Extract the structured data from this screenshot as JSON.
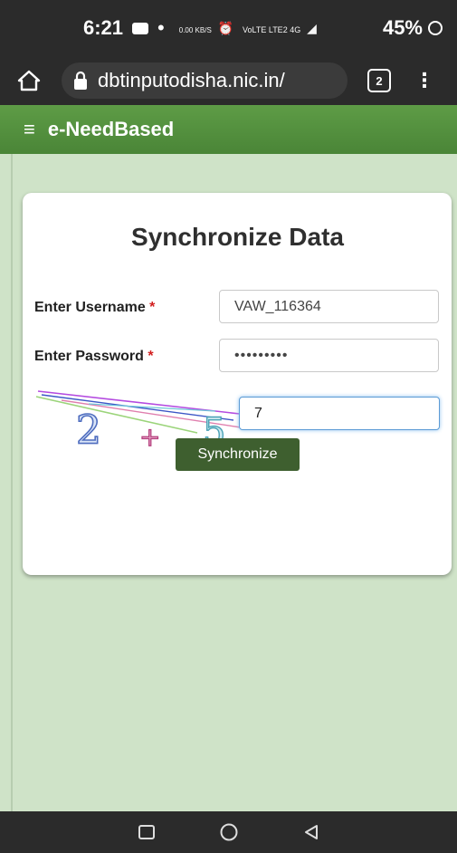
{
  "status_bar": {
    "time": "6:21",
    "net_speed": "0.00 KB/S",
    "indicators": "VoLTE LTE2 4G",
    "battery": "45%"
  },
  "browser": {
    "url": "dbtinputodisha.nic.in/",
    "tab_count": "2"
  },
  "header": {
    "app_name": "e-NeedBased",
    "color": "#4f8a3c"
  },
  "form": {
    "title": "Synchronize Data",
    "username_label": "Enter Username",
    "password_label": "Enter Password",
    "required_mark": "*",
    "username_value": "VAW_116364",
    "password_value": "•••••••••",
    "captcha_text": "2 + 5",
    "captcha_answer": "7",
    "submit_label": "Synchronize"
  },
  "icons": {
    "home": "home-icon",
    "lock": "lock-icon",
    "menu": "hamburger-icon",
    "nav": [
      "recents-icon",
      "home-circle-icon",
      "back-icon"
    ]
  }
}
